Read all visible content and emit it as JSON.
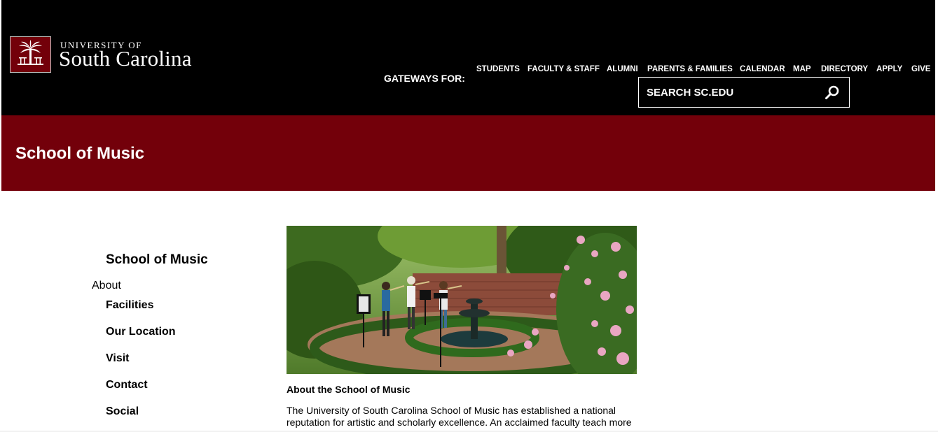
{
  "header": {
    "logo": {
      "line1": "UNIVERSITY OF",
      "line2": "South Carolina",
      "emblem": "palmetto-tree-icon"
    },
    "gateways_label": "GATEWAYS FOR:",
    "gateways": [
      "STUDENTS",
      "FACULTY & STAFF",
      "ALUMNI",
      "PARENTS & FAMILIES",
      "CALENDAR",
      "MAP",
      "DIRECTORY",
      "APPLY",
      "GIVE"
    ],
    "search": {
      "placeholder": "SEARCH SC.EDU",
      "icon": "search-icon"
    }
  },
  "banner": {
    "title": "School of Music"
  },
  "sidebar": {
    "heading": "School of Music",
    "about": "About",
    "items": [
      "Facilities",
      "Our Location",
      "Visit",
      "Contact",
      "Social"
    ]
  },
  "main": {
    "image": "garden-performance-photo",
    "heading": "About the School of Music",
    "body": "The University of South Carolina School of Music has established a national reputation for artistic and scholarly excellence. An acclaimed faculty teach more"
  },
  "colors": {
    "garnet": "#73000a",
    "black": "#000000",
    "white": "#ffffff"
  }
}
